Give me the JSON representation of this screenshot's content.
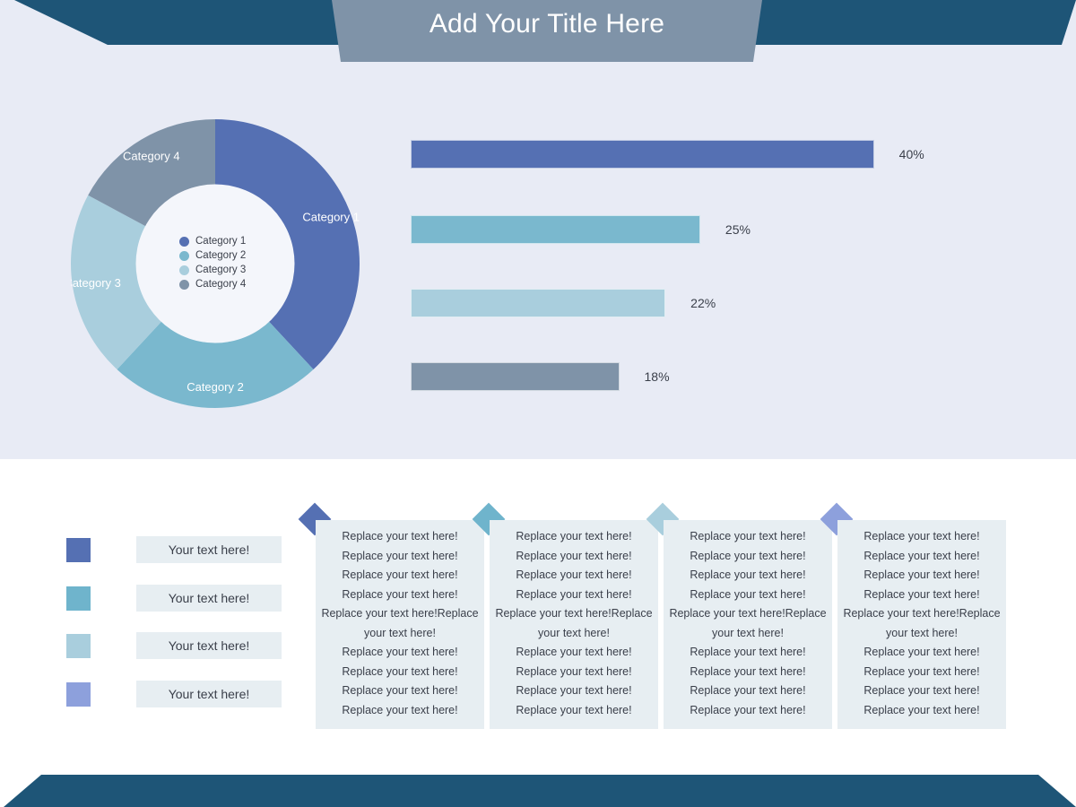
{
  "header": {
    "title": "Add Your Title Here",
    "banner_left_color": "#1e5577",
    "banner_right_color": "#1e5577",
    "banner_center_color": "#7f93a8",
    "title_color": "#ffffff"
  },
  "footer": {
    "bar_color": "#1e5577"
  },
  "palette": {
    "background_top": "#e8ebf5",
    "background_bottom": "#ffffff",
    "series": [
      "#5570b3",
      "#7ab8ce",
      "#a9cedd",
      "#7f93a8"
    ],
    "accent_periwinkle": "#8da0dc",
    "chip_background": "#e7eef2"
  },
  "chart_data": [
    {
      "type": "pie",
      "variant": "donut",
      "title": "",
      "labels": [
        "Category 1",
        "Category 2",
        "Category 3",
        "Category 4"
      ],
      "values": [
        40,
        25,
        22,
        18
      ],
      "unit": "%",
      "colors": [
        "#5570b3",
        "#7ab8ce",
        "#a9cedd",
        "#7f93a8"
      ],
      "start_angle_deg": 0,
      "direction": "clockwise",
      "inner_radius_ratio": 0.55,
      "legend": {
        "position": "center",
        "entries": [
          "Category 1",
          "Category 2",
          "Category 3",
          "Category 4"
        ],
        "marker": "circle"
      },
      "slice_labels_shown": true
    },
    {
      "type": "bar",
      "orientation": "horizontal",
      "title": "",
      "xlabel": "",
      "ylabel": "",
      "categories": [
        "Category 1",
        "Category 2",
        "Category 3",
        "Category 4"
      ],
      "values": [
        40,
        25,
        22,
        18
      ],
      "value_labels": [
        "40%",
        "25%",
        "22%",
        "18%"
      ],
      "colors": [
        "#5570b3",
        "#7ab8ce",
        "#a9cedd",
        "#7f93a8"
      ],
      "xlim": [
        0,
        48
      ],
      "grid": false,
      "legend_position": "none"
    }
  ],
  "legend_list": {
    "items": [
      {
        "label": "Your text here!",
        "color": "#5570b3"
      },
      {
        "label": "Your text here!",
        "color": "#6fb4cc"
      },
      {
        "label": "Your text here!",
        "color": "#a9cedd"
      },
      {
        "label": "Your text here!",
        "color": "#8da0dc"
      }
    ]
  },
  "text_columns": [
    {
      "marker_color": "#5570b3",
      "lines": [
        "Replace your text here!",
        "Replace your text here!",
        "Replace your text here!",
        "Replace your text here!",
        "Replace your text here!Replace your text here!",
        "Replace your text here!",
        "Replace your text here!",
        "Replace your text here!",
        "Replace your text here!"
      ]
    },
    {
      "marker_color": "#6fb4cc",
      "lines": [
        "Replace your text here!",
        "Replace your text here!",
        "Replace your text here!",
        "Replace your text here!",
        "Replace your text here!Replace your text here!",
        "Replace your text here!",
        "Replace your text here!",
        "Replace your text here!",
        "Replace your text here!"
      ]
    },
    {
      "marker_color": "#a9cedd",
      "lines": [
        "Replace your text here!",
        "Replace your text here!",
        "Replace your text here!",
        "Replace your text here!",
        "Replace your text here!Replace your text here!",
        "Replace your text here!",
        "Replace your text here!",
        "Replace your text here!",
        "Replace your text here!"
      ]
    },
    {
      "marker_color": "#8da0dc",
      "lines": [
        "Replace your text here!",
        "Replace your text here!",
        "Replace your text here!",
        "Replace your text here!",
        "Replace your text here!Replace your text here!",
        "Replace your text here!",
        "Replace your text here!",
        "Replace your text here!",
        "Replace your text here!"
      ]
    }
  ]
}
